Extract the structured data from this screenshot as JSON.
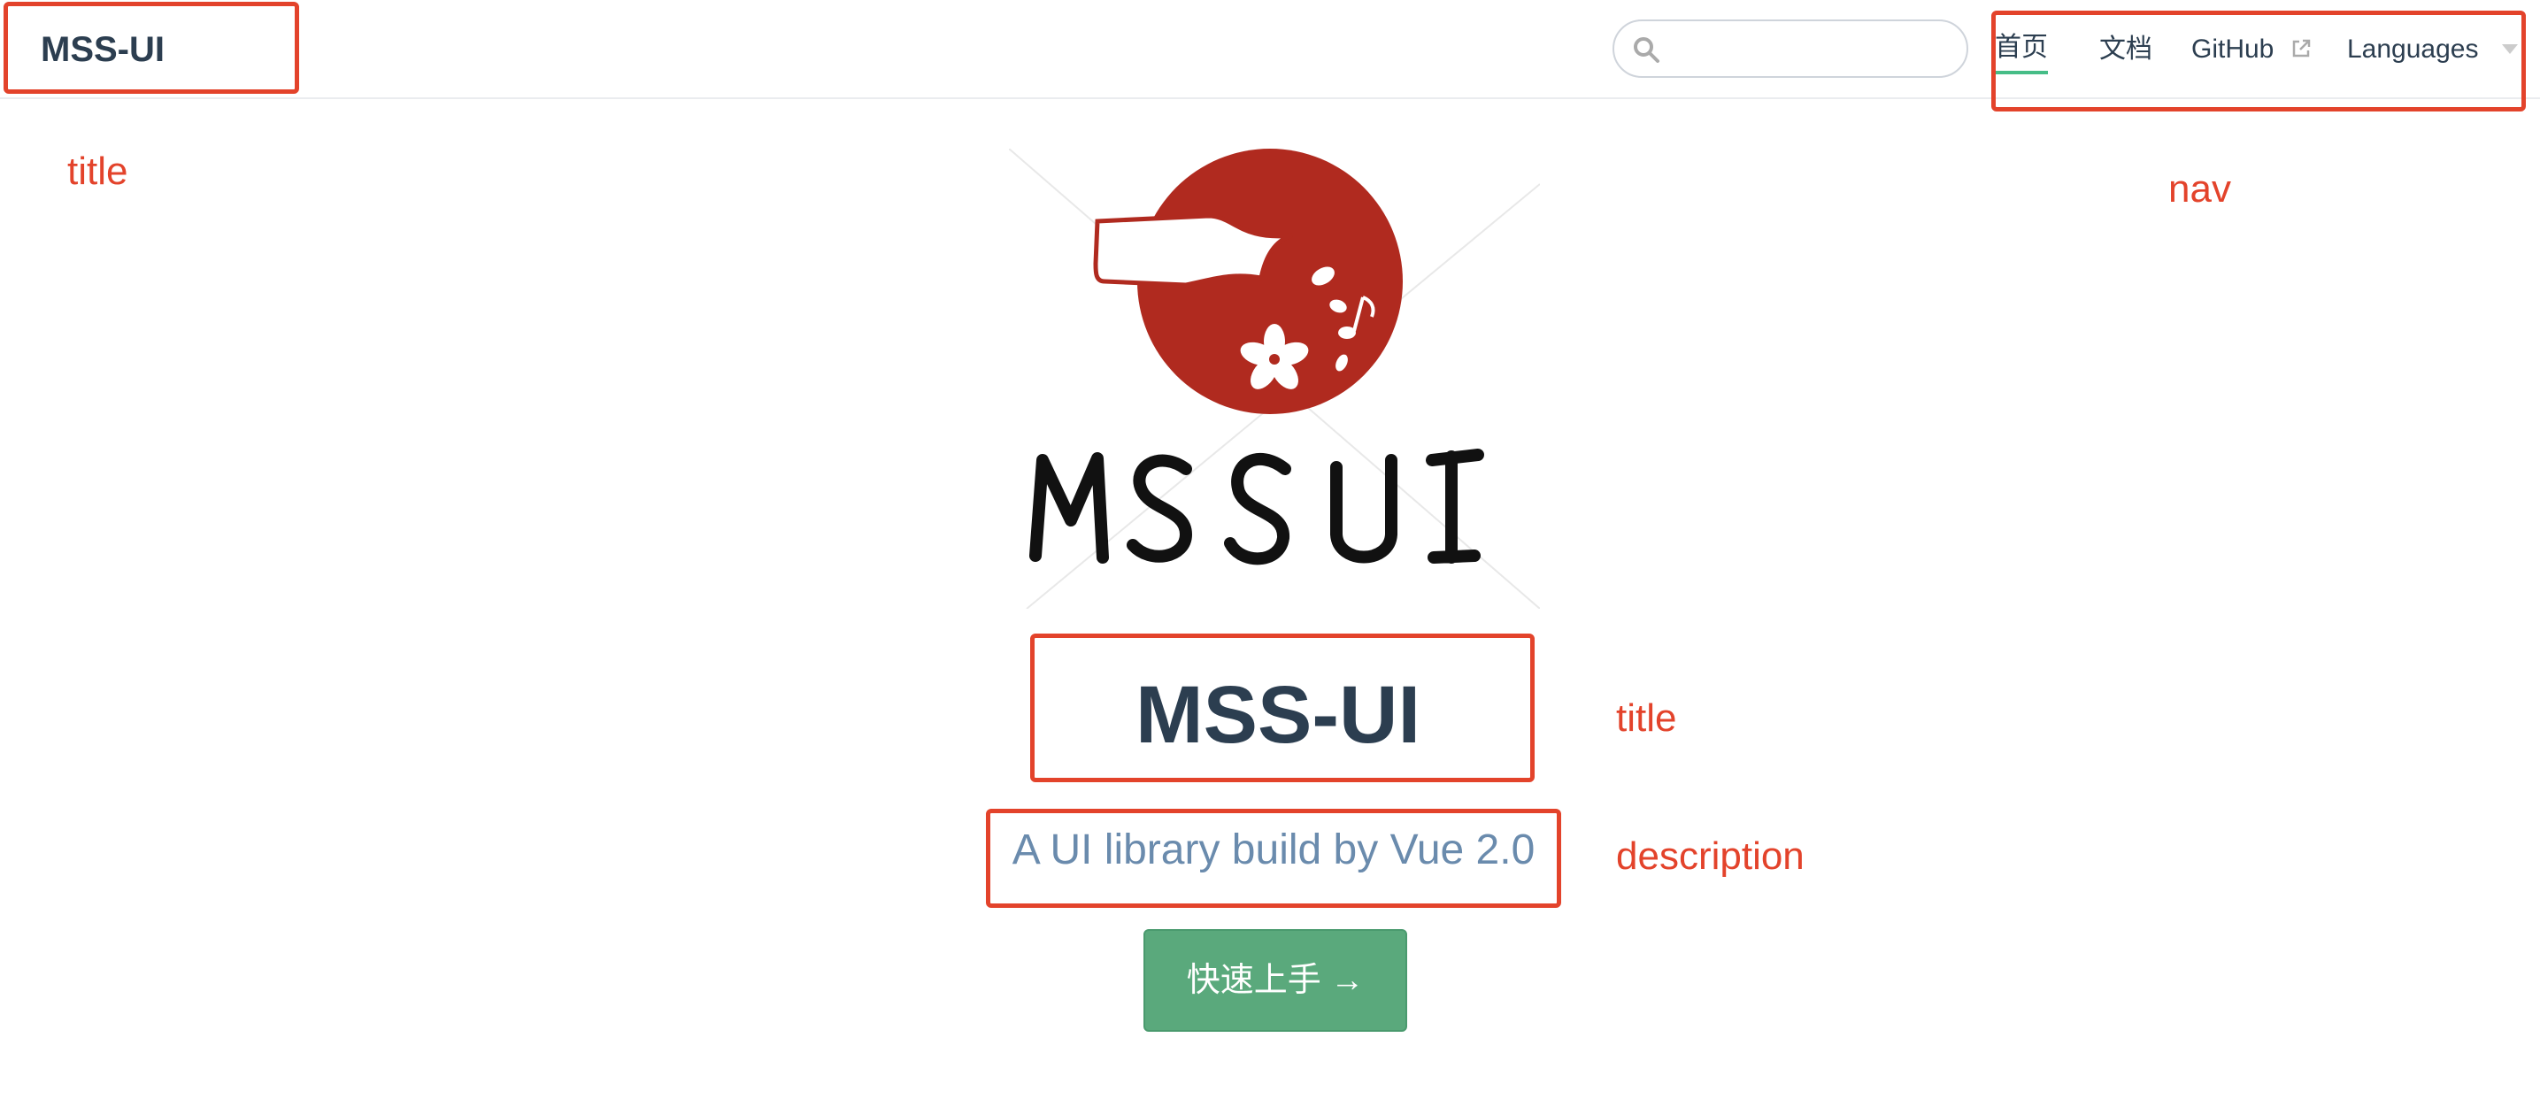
{
  "navbar": {
    "site_name": "MSS-UI",
    "search": {
      "value": "",
      "placeholder": ""
    },
    "links": [
      {
        "label": "首页",
        "active": true
      },
      {
        "label": "文档",
        "active": false
      },
      {
        "label": "GitHub",
        "external": true
      },
      {
        "label": "Languages",
        "dropdown": true
      }
    ]
  },
  "hero": {
    "logo_text": "MSSUI",
    "title": "MSS-UI",
    "description": "A UI library build by Vue 2.0",
    "action_label": "快速上手 →"
  },
  "annotations": {
    "title_top": "title",
    "nav": "nav",
    "title_hero": "title",
    "description": "description"
  },
  "colors": {
    "accent": "#46bd87",
    "button_bg": "#5aa97c",
    "annotation": "#e3432b",
    "logo_red": "#b02a1f",
    "text_primary": "#2c3e50",
    "text_description": "#6a8bad"
  }
}
